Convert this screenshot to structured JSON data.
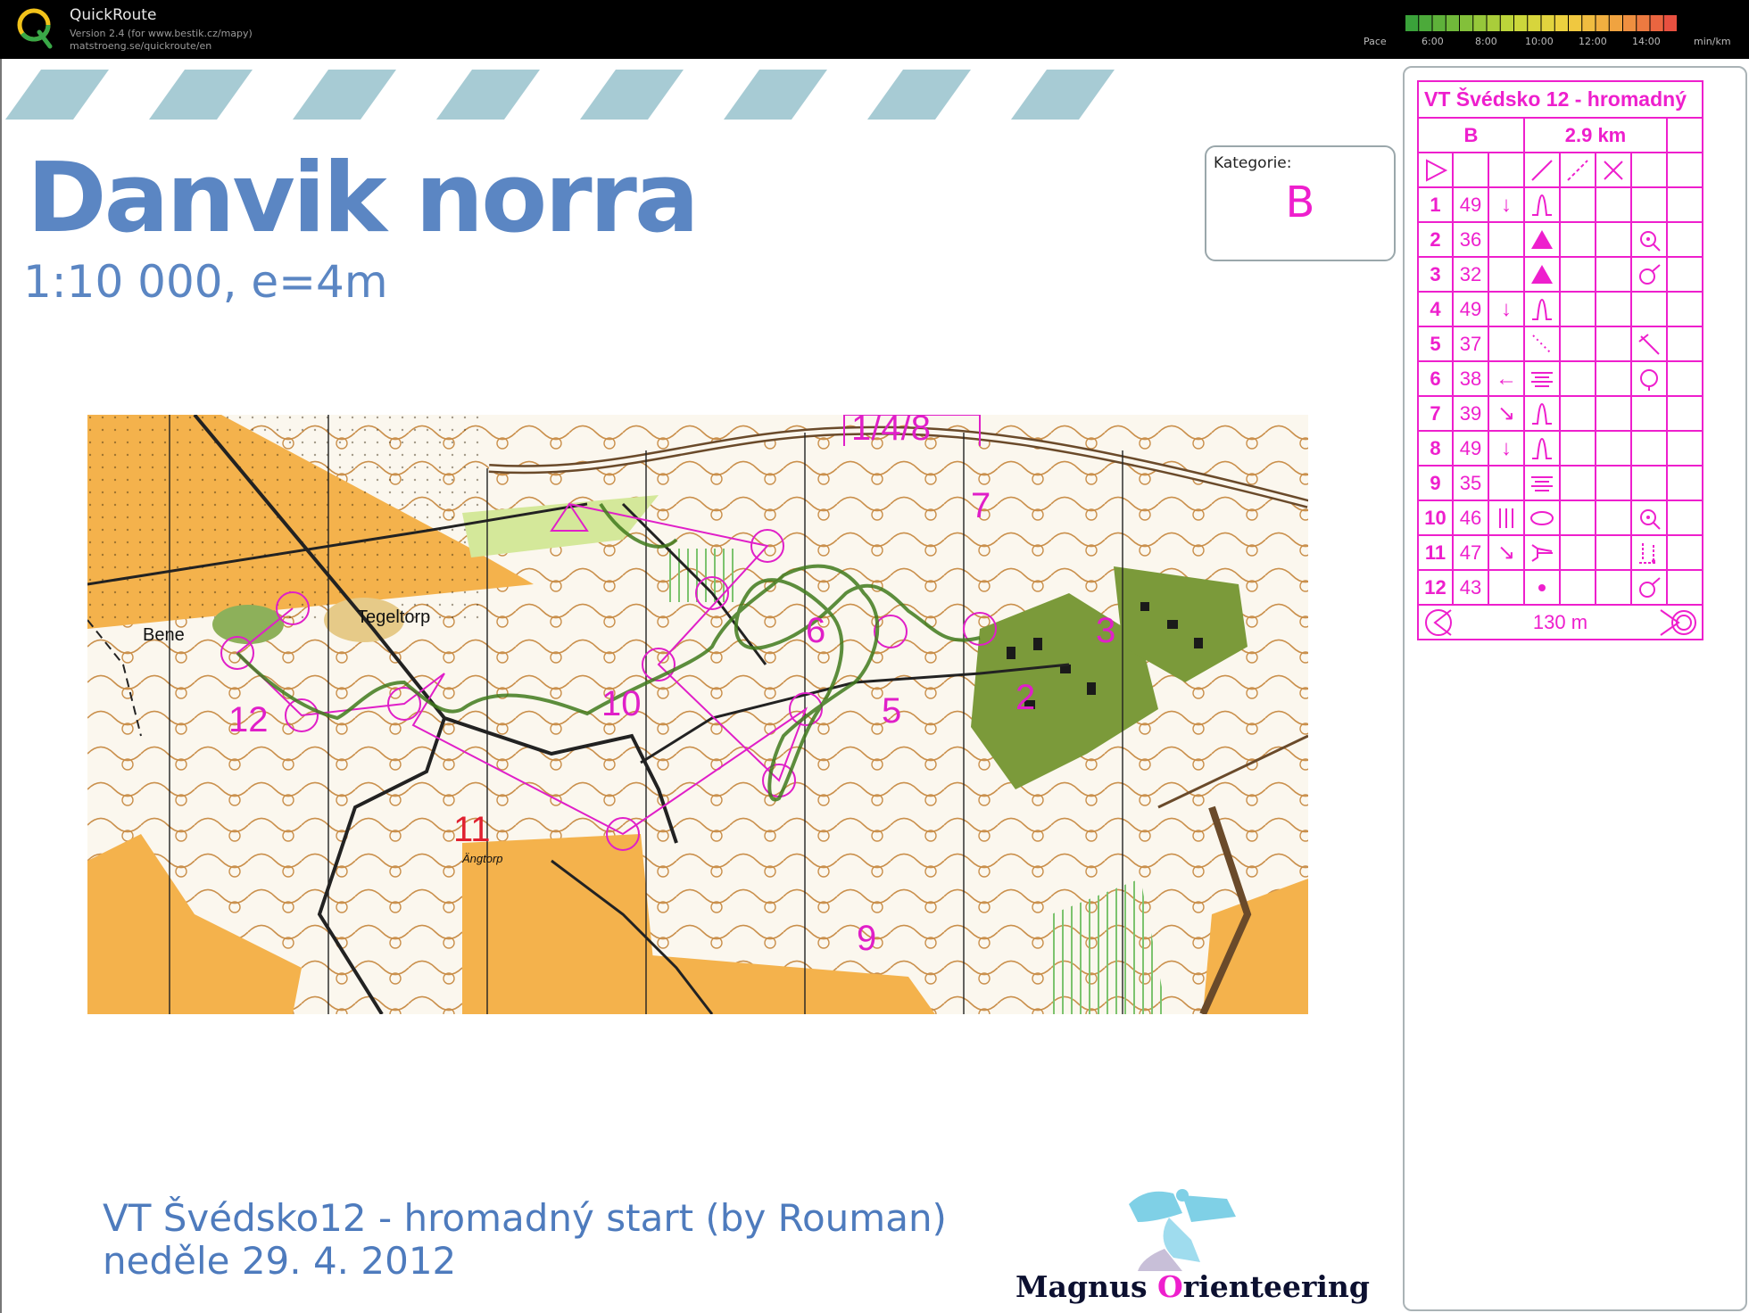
{
  "app": {
    "title": "QuickRoute",
    "version": "Version 2.4  (for www.bestik.cz/mapy)",
    "url": "matstroeng.se/quickroute/en"
  },
  "pace_legend": {
    "label": "Pace",
    "ticks": [
      "6:00",
      "8:00",
      "10:00",
      "12:00",
      "14:00"
    ],
    "unit": "min/km",
    "colors": [
      "#3aa23a",
      "#7fbf3a",
      "#c8d83a",
      "#f0d040",
      "#f0a040",
      "#e85040"
    ]
  },
  "map": {
    "title": "Danvik norra",
    "scale": "1:10 000, e=4m",
    "category_label": "Kategorie:",
    "category_value": "B",
    "place_labels": [
      "Tegeltorp",
      "Bene",
      "Ängtorp"
    ],
    "control_labels": [
      "1/4/8",
      "2",
      "3",
      "5",
      "6",
      "7",
      "9",
      "10",
      "11",
      "12"
    ],
    "course_color": "#e01fc8",
    "route_color": "#3f7a1c"
  },
  "footer": {
    "line1": "VT Švédsko12 - hromadný start (by Rouman)",
    "line2": "neděle 29. 4. 2012",
    "sponsor_word1": "Magnus ",
    "sponsor_initial": "O",
    "sponsor_rest": "rienteering"
  },
  "control_descriptions": {
    "event": "VT Švédsko 12 - hromadný",
    "class": "B",
    "length": "2.9 km",
    "rows": [
      {
        "num": "1",
        "code": "49",
        "dir": "↓",
        "feature": "knoll"
      },
      {
        "num": "2",
        "code": "36",
        "dir": "",
        "feature": "boulder",
        "pos": "inside"
      },
      {
        "num": "3",
        "code": "32",
        "dir": "",
        "feature": "boulder",
        "pos": "side"
      },
      {
        "num": "4",
        "code": "49",
        "dir": "↓",
        "feature": "knoll"
      },
      {
        "num": "5",
        "code": "37",
        "dir": "",
        "feature": "path-end",
        "pos": "corner"
      },
      {
        "num": "6",
        "code": "38",
        "dir": "←",
        "feature": "marsh",
        "pos": "ring"
      },
      {
        "num": "7",
        "code": "39",
        "dir": "↘",
        "feature": "knoll"
      },
      {
        "num": "8",
        "code": "49",
        "dir": "↓",
        "feature": "knoll"
      },
      {
        "num": "9",
        "code": "35",
        "dir": "",
        "feature": "marsh"
      },
      {
        "num": "10",
        "code": "46",
        "dir": "|||",
        "feature": "oval",
        "pos": "inside"
      },
      {
        "num": "11",
        "code": "47",
        "dir": "↘",
        "feature": "spur",
        "pos": "foot"
      },
      {
        "num": "12",
        "code": "43",
        "dir": "",
        "feature": "dot",
        "pos": "side"
      }
    ],
    "finish": "130 m"
  }
}
